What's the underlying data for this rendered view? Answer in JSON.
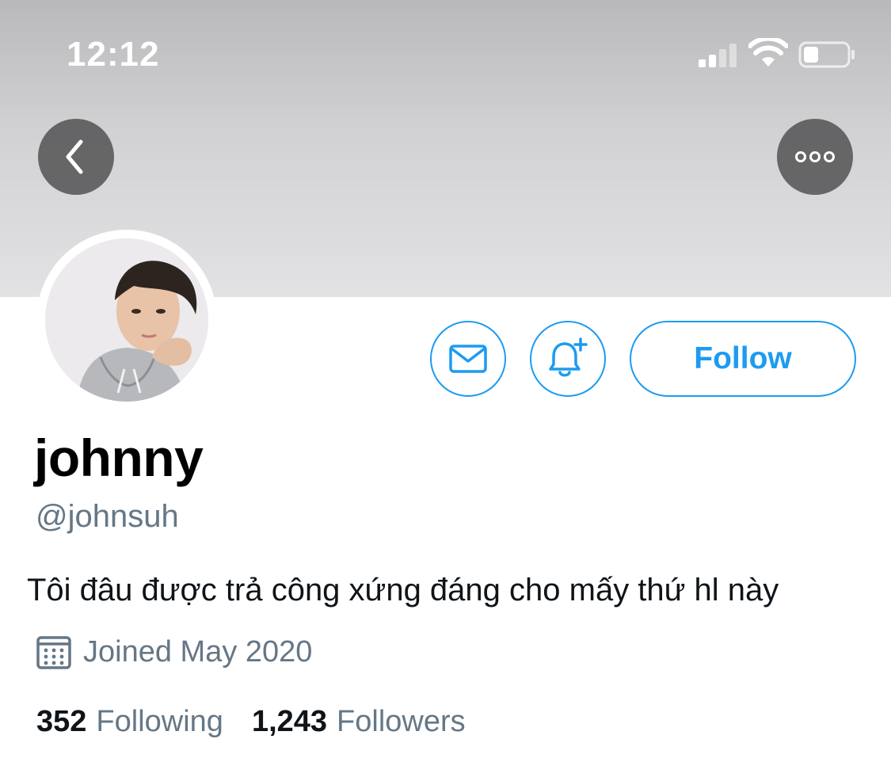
{
  "status_bar": {
    "time": "12:12"
  },
  "profile": {
    "display_name": "johnny",
    "handle": "@johnsuh",
    "bio": "Tôi đâu được trả công xứng đáng cho mấy thứ hl này",
    "joined": "Joined May 2020",
    "following_count": "352",
    "following_label": "Following",
    "followers_count": "1,243",
    "followers_label": "Followers"
  },
  "actions": {
    "follow_label": "Follow"
  },
  "icons": {
    "back": "chevron-left-icon",
    "more": "more-horizontal-icon",
    "message": "envelope-icon",
    "notify": "bell-plus-icon",
    "calendar": "calendar-icon"
  },
  "colors": {
    "accent": "#1d9bf0",
    "secondary_text": "#657786",
    "primary_text": "#0f1419"
  }
}
